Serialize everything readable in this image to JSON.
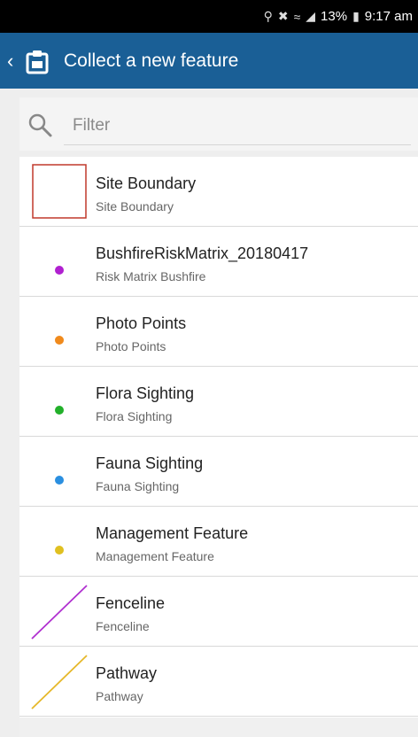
{
  "status_bar": {
    "battery": "13%",
    "time": "9:17 am",
    "icons": [
      "location-icon",
      "mute-icon",
      "wifi-icon",
      "signal-icon",
      "battery-icon"
    ]
  },
  "app_bar": {
    "title": "Collect a new feature",
    "icons": [
      "back-chevron-icon",
      "collect-feature-icon"
    ],
    "background_color": "#1a5f96"
  },
  "search": {
    "placeholder": "Filter",
    "value": "",
    "icon": "search-icon"
  },
  "features": [
    {
      "title": "Site Boundary",
      "subtitle": "Site Boundary",
      "symbol": "polygon",
      "color": "#c0392b"
    },
    {
      "title": "BushfireRiskMatrix_20180417",
      "subtitle": "Risk Matrix Bushfire",
      "symbol": "point",
      "color": "#b020d0"
    },
    {
      "title": "Photo Points",
      "subtitle": "Photo Points",
      "symbol": "point",
      "color": "#f08a1c"
    },
    {
      "title": "Flora Sighting",
      "subtitle": "Flora Sighting",
      "symbol": "point",
      "color": "#22b02a"
    },
    {
      "title": "Fauna Sighting",
      "subtitle": "Fauna Sighting",
      "symbol": "point",
      "color": "#2a8fe0"
    },
    {
      "title": "Management Feature",
      "subtitle": "Management Feature",
      "symbol": "point",
      "color": "#e0c020"
    },
    {
      "title": "Fenceline",
      "subtitle": "Fenceline",
      "symbol": "line",
      "color": "#b030d0"
    },
    {
      "title": "Pathway",
      "subtitle": "Pathway",
      "symbol": "line",
      "color": "#e6b82a"
    }
  ]
}
